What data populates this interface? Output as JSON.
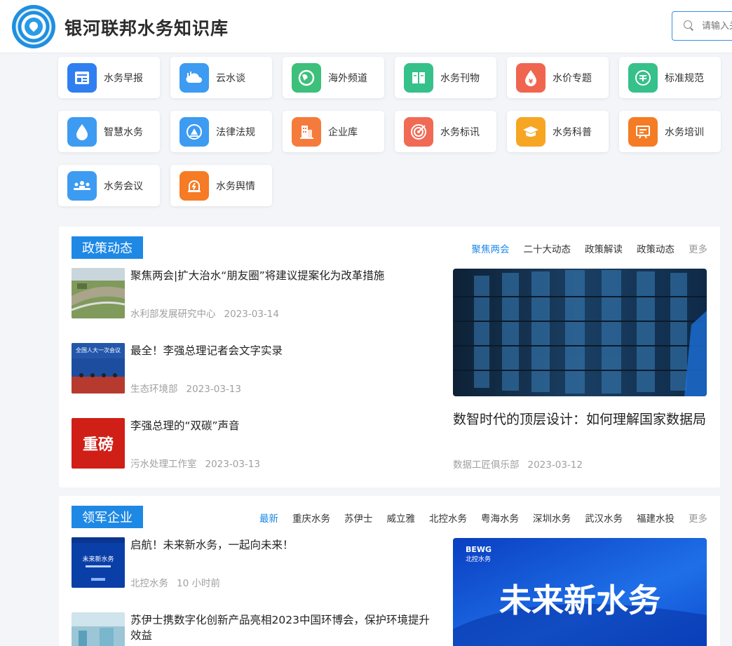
{
  "header": {
    "site_title": "银河联邦水务知识库",
    "search_placeholder": "请输入关键词"
  },
  "tiles": [
    {
      "label": "水务早报",
      "icon": "newspaper-icon",
      "color": "#2f7ff0"
    },
    {
      "label": "云水谈",
      "icon": "cloud-chart-icon",
      "color": "#3d9bf2"
    },
    {
      "label": "海外频道",
      "icon": "globe-icon",
      "color": "#3cc07a"
    },
    {
      "label": "水务刊物",
      "icon": "book-icon",
      "color": "#36c08a"
    },
    {
      "label": "水价专题",
      "icon": "price-drop-icon",
      "color": "#f0654f"
    },
    {
      "label": "标准规范",
      "icon": "standard-icon",
      "color": "#36c08a"
    },
    {
      "label": "智慧水务",
      "icon": "water-drop-icon",
      "color": "#3d9bf2"
    },
    {
      "label": "法律法规",
      "icon": "law-icon",
      "color": "#3d9bf2"
    },
    {
      "label": "企业库",
      "icon": "building-icon",
      "color": "#f57b3c"
    },
    {
      "label": "水务标讯",
      "icon": "target-icon",
      "color": "#f06a55"
    },
    {
      "label": "水务科普",
      "icon": "graduation-cap-icon",
      "color": "#f6a623"
    },
    {
      "label": "水务培训",
      "icon": "presentation-icon",
      "color": "#f57b24"
    },
    {
      "label": "水务会议",
      "icon": "meeting-icon",
      "color": "#3d9bf2"
    },
    {
      "label": "水务舆情",
      "icon": "alert-icon",
      "color": "#f57b24"
    }
  ],
  "policy": {
    "title": "政策动态",
    "tabs": [
      "聚焦两会",
      "二十大动态",
      "政策解读",
      "政策动态"
    ],
    "more": "更多",
    "news": [
      {
        "title": "聚焦两会|扩大治水“朋友圈”将建议提案化为改革措施",
        "source": "水利部发展研究中心",
        "date": "2023-03-14"
      },
      {
        "title": "最全！李强总理记者会文字实录",
        "source": "生态环境部",
        "date": "2023-03-13",
        "thumb_text": "全国人大一次会议"
      },
      {
        "title": "李强总理的“双碳”声音",
        "source": "污水处理工作室",
        "date": "2023-03-13",
        "thumb_text": "重磅"
      }
    ],
    "feature": {
      "title": "数智时代的顶层设计：如何理解国家数据局",
      "source": "数据工匠俱乐部",
      "date": "2023-03-12"
    }
  },
  "enterprise": {
    "title": "领军企业",
    "tabs": [
      "最新",
      "重庆水务",
      "苏伊士",
      "威立雅",
      "北控水务",
      "粤海水务",
      "深圳水务",
      "武汉水务",
      "福建水投"
    ],
    "more": "更多",
    "news": [
      {
        "title": "启航！未来新水务，一起向未来！",
        "source": "北控水务",
        "date": "10 小时前",
        "thumb_text": "未来新水务"
      },
      {
        "title": "苏伊士携数字化创新产品亮相2023中国环博会，保护环境提升效益",
        "source": "",
        "date": ""
      }
    ],
    "feature": {
      "brand": "BEWG",
      "brand_sub": "北控水务",
      "banner_text": "未来新水务"
    }
  },
  "colors": {
    "accent": "#1e88e5",
    "meta_text": "#a0a0a0",
    "page_bg": "#f3f5f8"
  }
}
